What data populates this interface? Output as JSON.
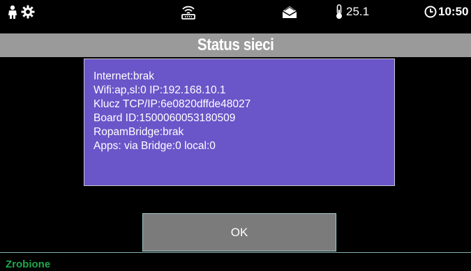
{
  "statusbar": {
    "icons": {
      "left_person": "person-icon",
      "left_gear": "gear-icon",
      "wifi_router": "wifi-router-icon",
      "mail": "mail-icon",
      "thermometer": "thermometer-icon",
      "clock": "clock-icon"
    },
    "temperature": "25.1",
    "time": "10:50"
  },
  "title": "Status sieci",
  "info_lines": [
    "Internet:brak",
    "Wifi:ap,sl:0 IP:192.168.10.1",
    "Klucz TCP/IP:6e0820dffde48027",
    "Board ID:1500060053180509",
    "RopamBridge:brak",
    "Apps: via Bridge:0 local:0"
  ],
  "ok_label": "OK",
  "footer_status": "Zrobione",
  "colors": {
    "panel_bg": "#6a55c9",
    "title_bar": "#9a9a9a",
    "ok_button": "#7b7b7b",
    "footer_text": "#1ea84a"
  }
}
